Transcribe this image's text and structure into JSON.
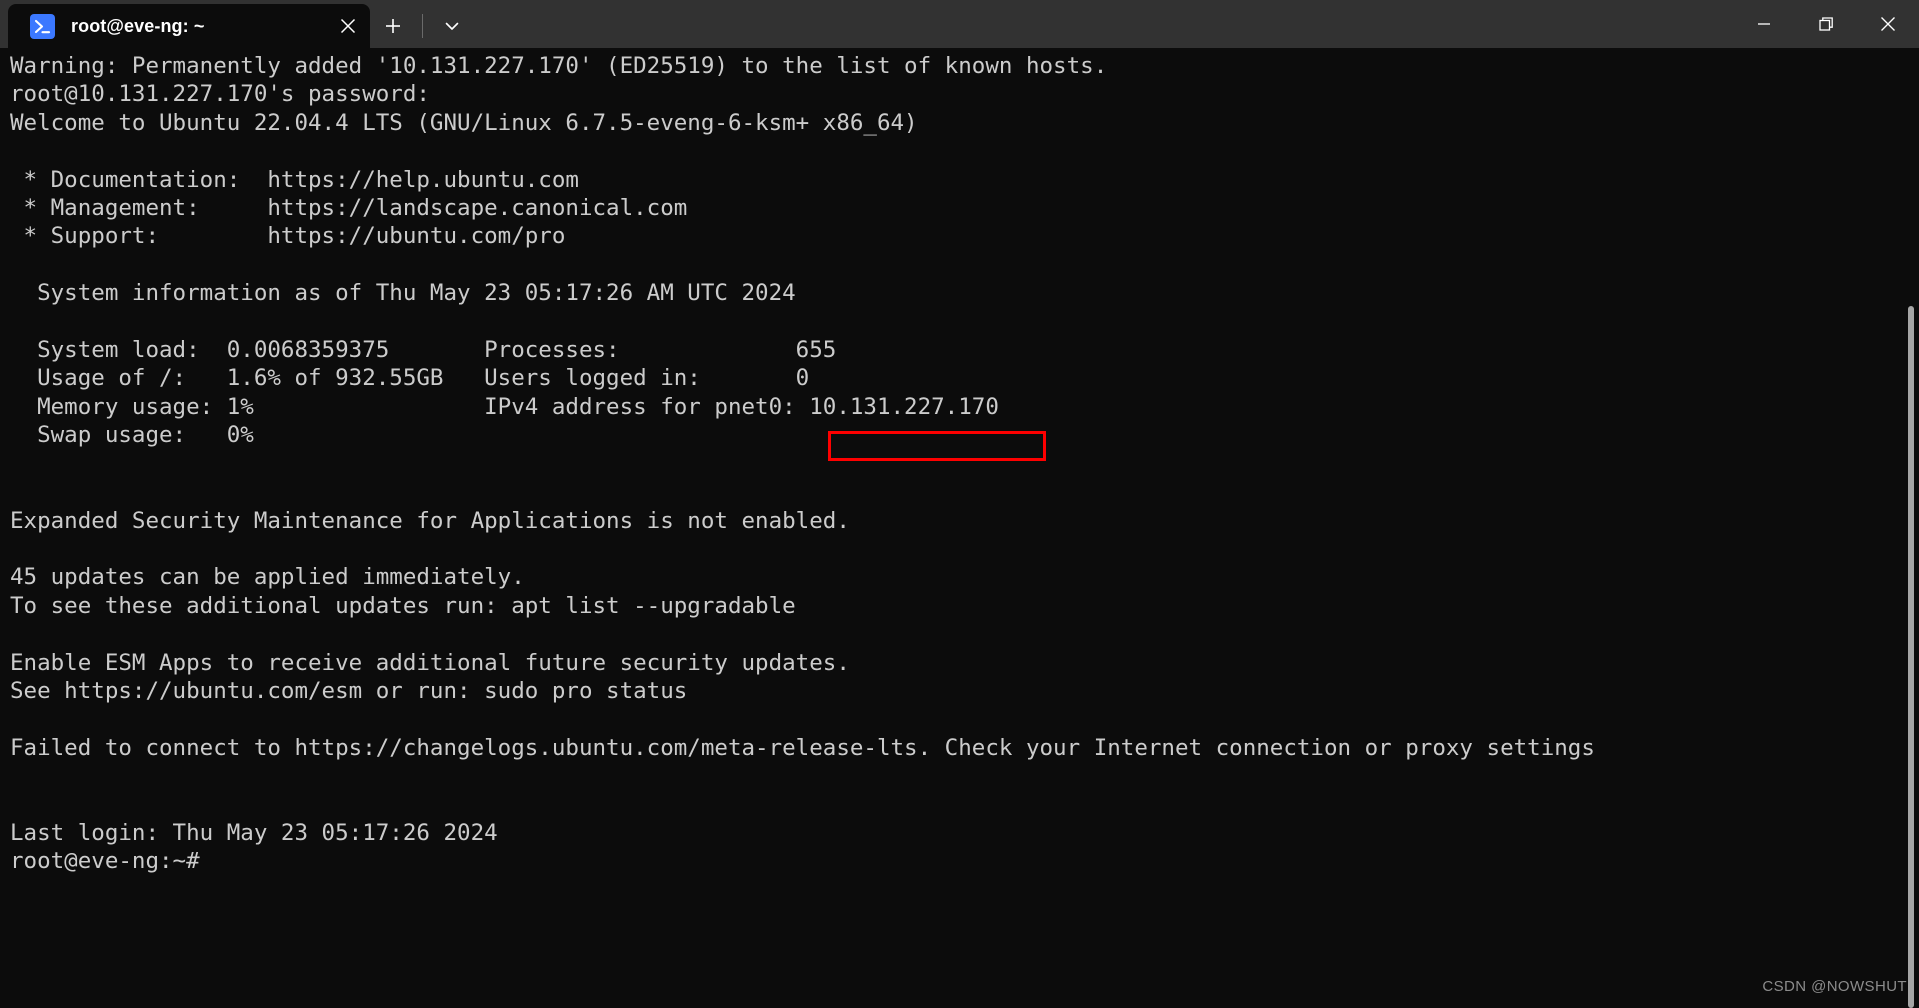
{
  "window": {
    "tab": {
      "title": "root@eve-ng: ~",
      "icon": "powershell-prompt-icon",
      "close_label": "Close tab"
    },
    "actions": {
      "new_tab_label": "New tab",
      "dropdown_label": "Open a new tab dropdown"
    },
    "controls": {
      "minimize_label": "Minimize",
      "restore_label": "Restore Down",
      "close_label": "Close"
    }
  },
  "terminal": {
    "content": "Warning: Permanently added '10.131.227.170' (ED25519) to the list of known hosts.\nroot@10.131.227.170's password:\nWelcome to Ubuntu 22.04.4 LTS (GNU/Linux 6.7.5-eveng-6-ksm+ x86_64)\n\n * Documentation:  https://help.ubuntu.com\n * Management:     https://landscape.canonical.com\n * Support:        https://ubuntu.com/pro\n\n  System information as of Thu May 23 05:17:26 AM UTC 2024\n\n  System load:  0.0068359375       Processes:             655\n  Usage of /:   1.6% of 932.55GB   Users logged in:       0\n  Memory usage: 1%                 IPv4 address for pnet0: 10.131.227.170\n  Swap usage:   0%\n\n\nExpanded Security Maintenance for Applications is not enabled.\n\n45 updates can be applied immediately.\nTo see these additional updates run: apt list --upgradable\n\nEnable ESM Apps to receive additional future security updates.\nSee https://ubuntu.com/esm or run: sudo pro status\n\nFailed to connect to https://changelogs.ubuntu.com/meta-release-lts. Check your Internet connection or proxy settings\n\n\nLast login: Thu May 23 05:17:26 2024\nroot@eve-ng:~#",
    "lines": {
      "ssh_warning": "Warning: Permanently added '10.131.227.170' (ED25519) to the list of known hosts.",
      "password_prompt": "root@10.131.227.170's password:",
      "welcome": "Welcome to Ubuntu 22.04.4 LTS (GNU/Linux 6.7.5-eveng-6-ksm+ x86_64)",
      "documentation": " * Documentation:  https://help.ubuntu.com",
      "management": " * Management:     https://landscape.canonical.com",
      "support": " * Support:        https://ubuntu.com/pro",
      "sysinfo_header": "  System information as of Thu May 23 05:17:26 AM UTC 2024",
      "esm_not_enabled": "Expanded Security Maintenance for Applications is not enabled.",
      "updates_count": "45 updates can be applied immediately.",
      "updates_hint": "To see these additional updates run: apt list --upgradable",
      "esm_enable": "Enable ESM Apps to receive additional future security updates.",
      "esm_see": "See https://ubuntu.com/esm or run: sudo pro status",
      "failed_connect": "Failed to connect to https://changelogs.ubuntu.com/meta-release-lts. Check your Internet connection or proxy settings",
      "last_login": "Last login: Thu May 23 05:17:26 2024",
      "prompt": "root@eve-ng:~#"
    },
    "system_information": {
      "timestamp": "Thu May 23 05:17:26 AM UTC 2024",
      "system_load_label": "System load:",
      "system_load_value": "0.0068359375",
      "usage_label": "Usage of /:",
      "usage_value": "1.6% of 932.55GB",
      "memory_label": "Memory usage:",
      "memory_value": "1%",
      "swap_label": "Swap usage:",
      "swap_value": "0%",
      "processes_label": "Processes:",
      "processes_value": "655",
      "users_label": "Users logged in:",
      "users_value": "0",
      "ipv4_label": "IPv4 address for pnet0:",
      "ipv4_value": "10.131.227.170"
    },
    "highlight": {
      "target_text": "10.131.227.170",
      "color": "#ff0000"
    }
  },
  "watermark": {
    "text": "CSDN @NOWSHUT"
  },
  "colors": {
    "titlebar_bg": "#323232",
    "terminal_bg": "#0c0c0c",
    "terminal_fg": "#cccccc",
    "tab_icon_bg": "#3b78ff",
    "annotation": "#ff0000"
  }
}
